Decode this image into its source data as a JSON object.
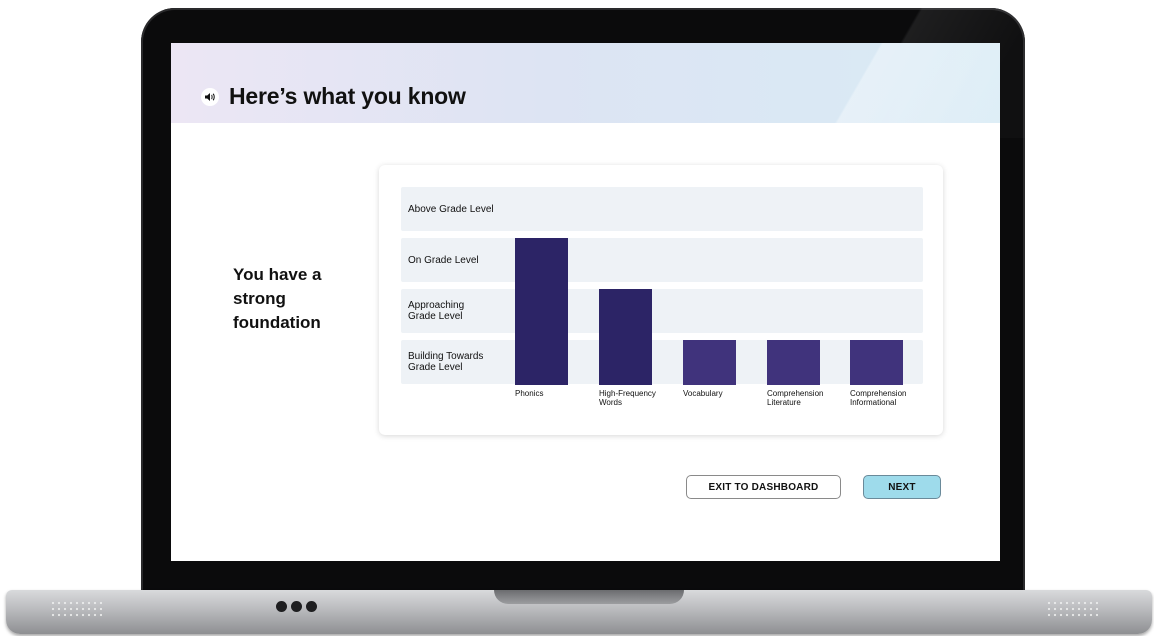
{
  "header": {
    "title": "Here’s what you know",
    "audio_icon": "speaker-icon"
  },
  "summary": {
    "lines": [
      "You have a",
      "strong",
      "foundation"
    ]
  },
  "chart_data": {
    "type": "bar",
    "levels": [
      {
        "lines": [
          "Building Towards",
          "Grade Level"
        ]
      },
      {
        "lines": [
          "Approaching",
          "Grade Level"
        ]
      },
      {
        "lines": [
          "On Grade Level"
        ]
      },
      {
        "lines": [
          "Above Grade Level"
        ]
      }
    ],
    "categories": [
      {
        "lines": [
          "Phonics"
        ]
      },
      {
        "lines": [
          "High-Frequency",
          "Words"
        ]
      },
      {
        "lines": [
          "Vocabulary"
        ]
      },
      {
        "lines": [
          "Comprehension",
          "Literature"
        ]
      },
      {
        "lines": [
          "Comprehension",
          "Informational"
        ]
      }
    ],
    "values": [
      3,
      2,
      1,
      1,
      1
    ],
    "y_range": [
      0,
      4
    ],
    "colors": {
      "strong": "#2c2466",
      "base": "#40337c",
      "band": "#eef2f6"
    }
  },
  "buttons": {
    "exit": "EXIT TO DASHBOARD",
    "next": "NEXT"
  }
}
